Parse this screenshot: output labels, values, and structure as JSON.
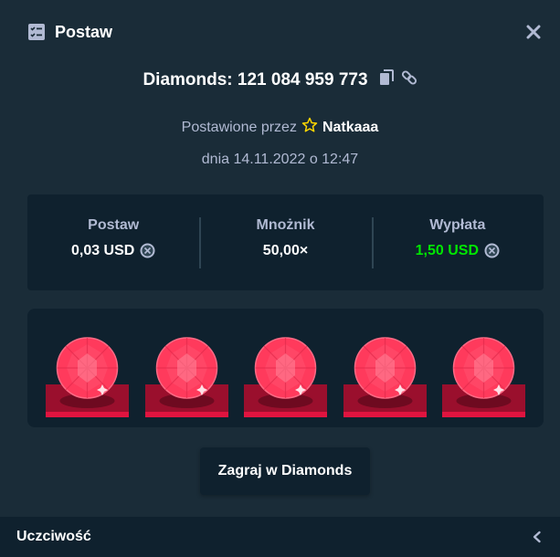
{
  "header": {
    "title": "Postaw",
    "icon": "bet-slip-icon",
    "close_icon": "close-icon"
  },
  "bet": {
    "game": "Diamonds",
    "title_text": "Diamonds: 121 084 959 773",
    "placed_by_label": "Postawione przez",
    "user": "Natkaaa",
    "date_text": "dnia 14.11.2022 o 12:47"
  },
  "stats": {
    "bet_label": "Postaw",
    "bet_value": "0,03 USD",
    "multiplier_label": "Mnożnik",
    "multiplier_value": "50,00×",
    "payout_label": "Wypłata",
    "payout_value": "1,50 USD"
  },
  "gems": [
    "red-diamond",
    "red-diamond",
    "red-diamond",
    "red-diamond",
    "red-diamond"
  ],
  "play_button": "Zagraj w Diamonds",
  "footer": {
    "label": "Uczciwość"
  },
  "colors": {
    "background": "#1a2c38",
    "panel": "#0f212e",
    "muted_text": "#b1bad3",
    "payout_green": "#00e701",
    "gem_red": "#ff3a5c",
    "star_yellow": "#ffd700"
  }
}
